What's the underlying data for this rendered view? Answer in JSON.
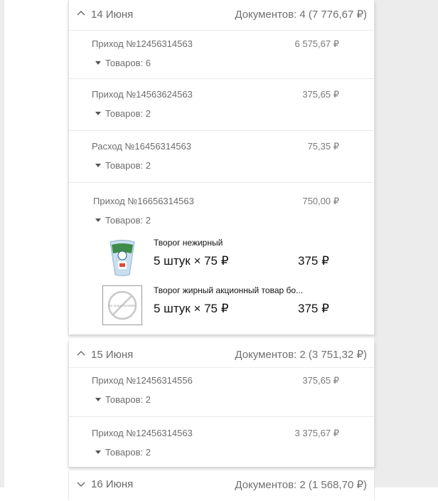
{
  "groups": [
    {
      "date": "14 Июня",
      "summary": "Документов: 4 (7 776,67 ₽)",
      "documents": [
        {
          "title": "Приход №12456314563",
          "amount": "6 575,67 ₽",
          "goods": "Товаров: 6"
        },
        {
          "title": "Приход №14563624563",
          "amount": "375,65 ₽",
          "goods": "Товаров: 2"
        },
        {
          "title": "Расход №16456314563",
          "amount": "75,35 ₽",
          "goods": "Товаров: 2"
        },
        {
          "title": "Приход №16656314563",
          "amount": "750,00 ₽",
          "goods": "Товаров: 2",
          "items": [
            {
              "name": "Творог нежирный",
              "qty": "5 штук  ×  75 ₽",
              "total": "375 ₽",
              "image": "cottage-cheese-pack"
            },
            {
              "name": "Творог жирный акционный товар бо...",
              "qty": "5 штук  ×  75 ₽",
              "total": "375 ₽",
              "image": "no-image-placeholder",
              "image_text": "No Image available"
            }
          ]
        }
      ]
    },
    {
      "date": "15 Июня",
      "summary": "Документов: 2 (3 751,32 ₽)",
      "documents": [
        {
          "title": "Приход №12456314556",
          "amount": "375,65 ₽",
          "goods": "Товаров: 2"
        },
        {
          "title": "Приход №12456314563",
          "amount": "3 375,67 ₽",
          "goods": "Товаров: 2"
        }
      ]
    },
    {
      "date": "16 Июня",
      "summary": "Документов: 2 (1 568,70 ₽)"
    }
  ]
}
